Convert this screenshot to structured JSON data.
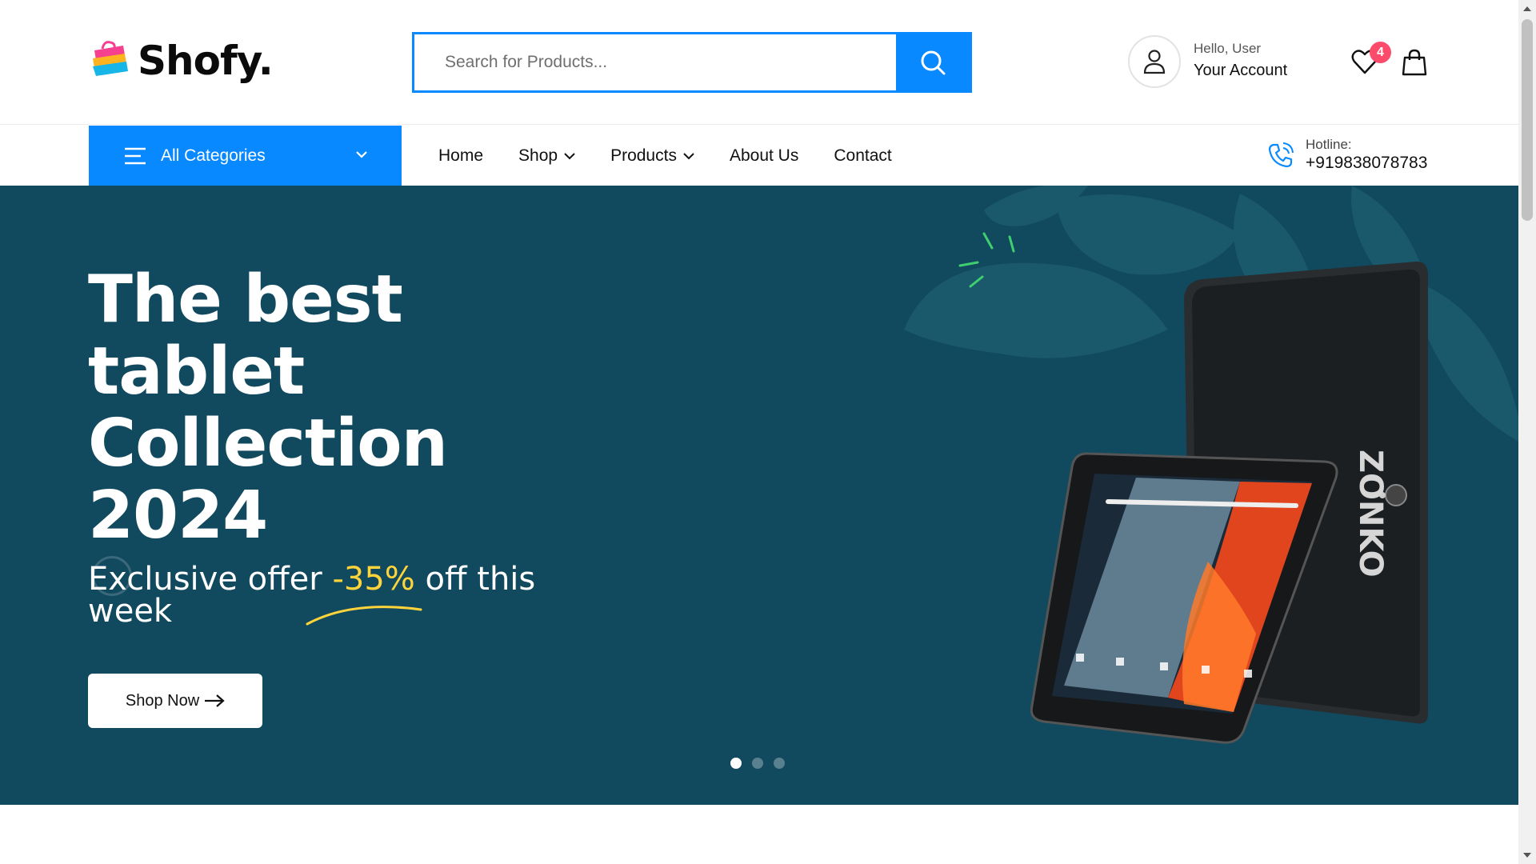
{
  "brand": {
    "name": "Shofy.",
    "colors": {
      "accent": "#0989ff",
      "hero_bg": "#11495e",
      "badge": "#fd4b6b",
      "highlight": "#ffd43b"
    }
  },
  "search": {
    "placeholder": "Search for Products...",
    "icon": "search-icon"
  },
  "account": {
    "greeting": "Hello, User",
    "label": "Your Account",
    "icon": "user-icon"
  },
  "wishlist": {
    "count": "4",
    "icon": "heart-icon"
  },
  "cart": {
    "icon": "shopping-bag-icon"
  },
  "nav": {
    "categories_label": "All Categories",
    "items": [
      {
        "label": "Home",
        "dropdown": false
      },
      {
        "label": "Shop",
        "dropdown": true
      },
      {
        "label": "Products",
        "dropdown": true
      },
      {
        "label": "About Us",
        "dropdown": false
      },
      {
        "label": "Contact",
        "dropdown": false
      }
    ],
    "hotline_label": "Hotline:",
    "hotline_number": "+919838078783"
  },
  "hero": {
    "title_lines": [
      "The best",
      "tablet",
      "Collection",
      "2024"
    ],
    "subtitle_pre": "Exclusive offer ",
    "subtitle_pct": "-35%",
    "subtitle_post": " off this week",
    "button_label": "Shop Now",
    "slide_count": 3,
    "active_slide": 0
  }
}
